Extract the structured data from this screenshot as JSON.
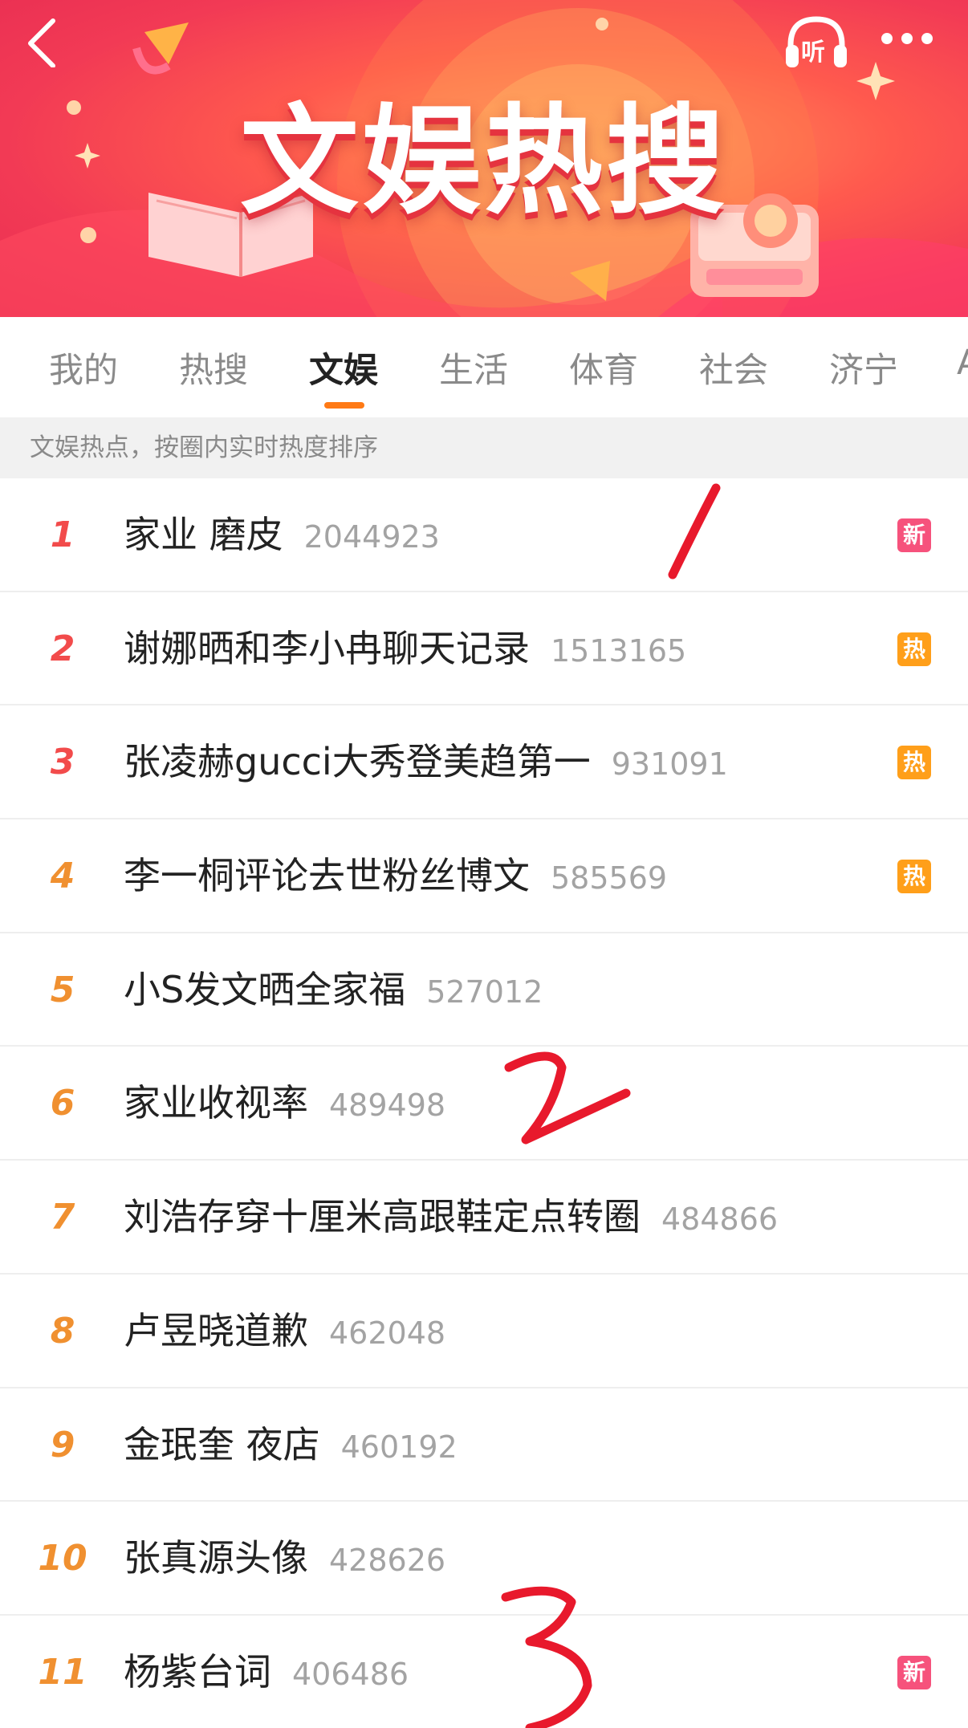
{
  "banner": {
    "title": "文娱热搜",
    "listen_label": "听"
  },
  "tabs": [
    {
      "label": "我的"
    },
    {
      "label": "热搜"
    },
    {
      "label": "文娱"
    },
    {
      "label": "生活"
    },
    {
      "label": "体育"
    },
    {
      "label": "社会"
    },
    {
      "label": "济宁"
    },
    {
      "label": "A"
    }
  ],
  "active_tab": "文娱",
  "subtitle": "文娱热点，按圈内实时热度排序",
  "colors": {
    "badge_new": "#f6527c",
    "badge_hot": "#ff9f1a",
    "rank_top": "#f24b4b",
    "rank_other": "#f09030",
    "tab_indicator": "#ff7a15",
    "annotation": "#e8192c"
  },
  "list": [
    {
      "rank": "1",
      "title": "家业 磨皮",
      "count": "2044923",
      "badge": "新"
    },
    {
      "rank": "2",
      "title": "谢娜晒和李小冉聊天记录",
      "count": "1513165",
      "badge": "热"
    },
    {
      "rank": "3",
      "title": "张凌赫gucci大秀登美趋第一",
      "count": "931091",
      "badge": "热"
    },
    {
      "rank": "4",
      "title": "李一桐评论去世粉丝博文",
      "count": "585569",
      "badge": "热"
    },
    {
      "rank": "5",
      "title": "小S发文晒全家福",
      "count": "527012",
      "badge": ""
    },
    {
      "rank": "6",
      "title": "家业收视率",
      "count": "489498",
      "badge": ""
    },
    {
      "rank": "7",
      "title": "刘浩存穿十厘米高跟鞋定点转圈",
      "count": "484866",
      "badge": ""
    },
    {
      "rank": "8",
      "title": "卢昱晓道歉",
      "count": "462048",
      "badge": ""
    },
    {
      "rank": "9",
      "title": "金珉奎 夜店",
      "count": "460192",
      "badge": ""
    },
    {
      "rank": "10",
      "title": "张真源头像",
      "count": "428626",
      "badge": ""
    },
    {
      "rank": "11",
      "title": "杨紫台词",
      "count": "406486",
      "badge": "新"
    }
  ]
}
